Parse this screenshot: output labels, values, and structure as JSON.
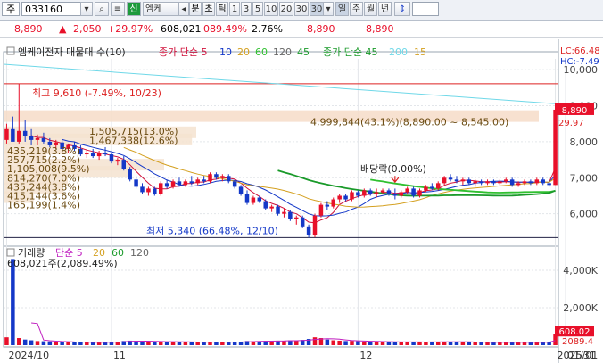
{
  "toolbar": {
    "market_label": "주",
    "code_value": "033160",
    "credit_badge": "신",
    "stock_name": "엠케",
    "period_tabs": [
      "분",
      "초",
      "틱",
      "1",
      "3",
      "5",
      "10",
      "20",
      "30",
      "30"
    ],
    "range_tabs": [
      "일",
      "주",
      "월",
      "년"
    ],
    "colors": {
      "up": "#e8102a",
      "down": "#1438c8",
      "accent": "#1e6fd9"
    }
  },
  "info": {
    "price": "8,890",
    "change": "2,050",
    "rate": "+29.97%",
    "volume": "608,021",
    "vol_rate": "089.49%",
    "turnover": "2.76%",
    "high": "8,890",
    "high2": "8,890"
  },
  "price_panel": {
    "legend": {
      "title": "엠케이전자 매물대 수(10)",
      "ma_label1": "종가 단순 5",
      "ma_values1": [
        "10",
        "20",
        "60",
        "120",
        "45"
      ],
      "ma_label2": "종가 단순 45",
      "ma_values2": [
        "200",
        "15"
      ]
    },
    "lc_label": "LC:66.48",
    "hc_label": "HC:-7.49",
    "max_label": "최고 9,610 (-7.49%, 10/23)",
    "min_label": "최저 5,340 (66.48%, 12/10)",
    "ex_div_label": "배당락(0.00%)",
    "volume_profile": [
      "4,999,844(43.1%)(8,890.00 ~ 8,545.00)",
      "1,505,715(13.0%)",
      "1,467,338(12.6%)",
      "435,219(3.8%)",
      "257,715(2.2%)",
      "1,105,008(9.5%)",
      "814,270(7.0%)",
      "435,244(3.8%)",
      "415,144(3.6%)",
      "165,199(1.4%)"
    ],
    "right_price_tag": "8,890",
    "right_rate_tag": "29.97"
  },
  "volume_panel": {
    "legend_title": "거래량",
    "legend_ma_label": "단순 5",
    "legend_ma_values": [
      "20",
      "60",
      "120"
    ],
    "last_label": "608,021주(2,089.49%)",
    "right_tag1": "608.02",
    "right_tag2": "2089.4"
  },
  "chart_data": {
    "type": "candlestick",
    "y_ticks": [
      "10,000",
      "9,000",
      "8,000",
      "7,000",
      "6,000"
    ],
    "ylim": [
      5200,
      10300
    ],
    "volume_y_ticks": [
      "4,000K",
      "2,000K"
    ],
    "volume_ylim": [
      0,
      5000
    ],
    "x_tick_labels": [
      "2024/10",
      "11",
      "12",
      "2025/01",
      "01/31"
    ],
    "x_tick_index": [
      0,
      17,
      57,
      97,
      127
    ],
    "overbought": 9610,
    "oversold": 5340,
    "candles": [
      [
        8050,
        8500,
        7950,
        8350
      ],
      [
        8350,
        8700,
        8200,
        8000
      ],
      [
        8000,
        9610,
        7950,
        8300
      ],
      [
        8300,
        8600,
        8000,
        8150
      ],
      [
        8150,
        8350,
        7900,
        8050
      ],
      [
        8050,
        8200,
        7900,
        8100
      ],
      [
        8100,
        8250,
        7950,
        8000
      ],
      [
        8000,
        8100,
        7850,
        7900
      ],
      [
        7900,
        8050,
        7800,
        7980
      ],
      [
        7980,
        8050,
        7750,
        7800
      ],
      [
        7800,
        7950,
        7700,
        7900
      ],
      [
        7900,
        8000,
        7750,
        7800
      ],
      [
        7800,
        7900,
        7600,
        7650
      ],
      [
        7650,
        7800,
        7550,
        7700
      ],
      [
        7700,
        7800,
        7550,
        7600
      ],
      [
        7600,
        7750,
        7500,
        7700
      ],
      [
        7700,
        7850,
        7600,
        7650
      ],
      [
        7650,
        7700,
        7400,
        7450
      ],
      [
        7450,
        7550,
        7350,
        7500
      ],
      [
        7500,
        7600,
        7200,
        7250
      ],
      [
        7250,
        7300,
        6900,
        6950
      ],
      [
        6950,
        7050,
        6700,
        6750
      ],
      [
        6750,
        6850,
        6550,
        6600
      ],
      [
        6600,
        6750,
        6500,
        6700
      ],
      [
        6700,
        6750,
        6500,
        6550
      ],
      [
        6550,
        6900,
        6500,
        6850
      ],
      [
        6850,
        6950,
        6700,
        6750
      ],
      [
        6750,
        6950,
        6700,
        6900
      ],
      [
        6900,
        7000,
        6750,
        6800
      ],
      [
        6800,
        6950,
        6750,
        6900
      ],
      [
        6900,
        7050,
        6800,
        6850
      ],
      [
        6850,
        7000,
        6800,
        6950
      ],
      [
        6950,
        7050,
        6850,
        6900
      ],
      [
        6900,
        7150,
        6850,
        7100
      ],
      [
        7100,
        7150,
        6950,
        7000
      ],
      [
        7000,
        7100,
        6900,
        7050
      ],
      [
        7050,
        7100,
        6850,
        6900
      ],
      [
        6900,
        6950,
        6700,
        6750
      ],
      [
        6750,
        6800,
        6500,
        6550
      ],
      [
        6550,
        6650,
        6250,
        6300
      ],
      [
        6300,
        6500,
        6250,
        6450
      ],
      [
        6450,
        6500,
        6300,
        6350
      ],
      [
        6350,
        6400,
        6100,
        6150
      ],
      [
        6150,
        6250,
        6050,
        6200
      ],
      [
        6200,
        6250,
        5950,
        6000
      ],
      [
        6000,
        6150,
        5900,
        6050
      ],
      [
        6050,
        6100,
        5800,
        5850
      ],
      [
        5850,
        5950,
        5700,
        5900
      ],
      [
        5900,
        5950,
        5600,
        5650
      ],
      [
        5650,
        5700,
        5340,
        5400
      ],
      [
        5400,
        6000,
        5350,
        5950
      ],
      [
        5950,
        6300,
        5900,
        6250
      ],
      [
        6250,
        6350,
        6100,
        6200
      ],
      [
        6200,
        6450,
        6150,
        6400
      ],
      [
        6400,
        6550,
        6300,
        6500
      ],
      [
        6500,
        6550,
        6350,
        6400
      ],
      [
        6400,
        6650,
        6350,
        6600
      ],
      [
        6600,
        6650,
        6450,
        6500
      ],
      [
        6500,
        6700,
        6450,
        6650
      ],
      [
        6650,
        6700,
        6500,
        6550
      ],
      [
        6550,
        6700,
        6450,
        6600
      ],
      [
        6600,
        6700,
        6550,
        6650
      ],
      [
        6650,
        6700,
        6500,
        6550
      ],
      [
        6550,
        6700,
        6400,
        6500
      ],
      [
        6500,
        6650,
        6450,
        6600
      ],
      [
        6600,
        6750,
        6550,
        6700
      ],
      [
        6700,
        6750,
        6450,
        6500
      ],
      [
        6500,
        6700,
        6450,
        6650
      ],
      [
        6650,
        6800,
        6600,
        6750
      ],
      [
        6750,
        6850,
        6650,
        6700
      ],
      [
        6700,
        6900,
        6650,
        6850
      ],
      [
        6850,
        7050,
        6800,
        7000
      ],
      [
        7000,
        7100,
        6900,
        6950
      ],
      [
        6950,
        7050,
        6850,
        6900
      ],
      [
        6900,
        7000,
        6800,
        6950
      ],
      [
        6950,
        7000,
        6800,
        6850
      ],
      [
        6850,
        6950,
        6750,
        6900
      ],
      [
        6900,
        6950,
        6800,
        6850
      ],
      [
        6850,
        6950,
        6800,
        6900
      ],
      [
        6900,
        6950,
        6800,
        6850
      ],
      [
        6850,
        6950,
        6800,
        6900
      ],
      [
        6900,
        7000,
        6850,
        6950
      ],
      [
        6950,
        7000,
        6750,
        6800
      ],
      [
        6800,
        6900,
        6750,
        6850
      ],
      [
        6850,
        6950,
        6800,
        6900
      ],
      [
        6900,
        6950,
        6800,
        6850
      ],
      [
        6850,
        7000,
        6800,
        6950
      ],
      [
        6950,
        7000,
        6800,
        6850
      ],
      [
        6850,
        6900,
        6750,
        6800
      ],
      [
        6800,
        8890,
        6800,
        8890
      ]
    ],
    "volumes": [
      420,
      4600,
      380,
      300,
      260,
      220,
      210,
      200,
      180,
      170,
      160,
      150,
      170,
      160,
      150,
      140,
      160,
      180,
      190,
      220,
      240,
      230,
      200,
      180,
      170,
      200,
      190,
      180,
      170,
      160,
      150,
      170,
      160,
      180,
      170,
      160,
      150,
      170,
      190,
      220,
      210,
      200,
      230,
      220,
      240,
      230,
      260,
      240,
      280,
      330,
      420,
      380,
      300,
      260,
      240,
      220,
      230,
      210,
      200,
      190,
      180,
      180,
      170,
      170,
      160,
      170,
      180,
      170,
      160,
      170,
      180,
      190,
      180,
      170,
      160,
      170,
      160,
      150,
      160,
      150,
      160,
      170,
      160,
      150,
      160,
      150,
      160,
      150,
      160,
      608
    ]
  }
}
